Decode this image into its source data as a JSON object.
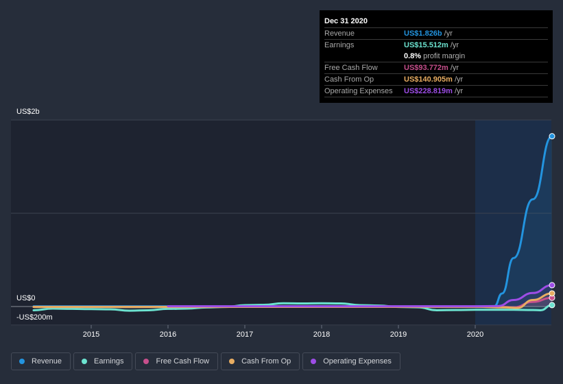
{
  "tooltip": {
    "date": "Dec 31 2020",
    "rows": [
      {
        "label": "Revenue",
        "value": "US$1.826b",
        "unit": "/yr",
        "color": "#2394df"
      },
      {
        "label": "Earnings",
        "value": "US$15.512m",
        "unit": "/yr",
        "color": "#6ce3d0"
      },
      {
        "label": "",
        "value": "0.8%",
        "unit": "profit margin",
        "color": "#ffffff"
      },
      {
        "label": "Free Cash Flow",
        "value": "US$93.772m",
        "unit": "/yr",
        "color": "#c74f8c"
      },
      {
        "label": "Cash From Op",
        "value": "US$140.905m",
        "unit": "/yr",
        "color": "#e8ad62"
      },
      {
        "label": "Operating Expenses",
        "value": "US$228.819m",
        "unit": "/yr",
        "color": "#9d4de6"
      }
    ]
  },
  "legend": [
    {
      "label": "Revenue",
      "color": "#2394df"
    },
    {
      "label": "Earnings",
      "color": "#6ce3d0"
    },
    {
      "label": "Free Cash Flow",
      "color": "#c74f8c"
    },
    {
      "label": "Cash From Op",
      "color": "#e8ad62"
    },
    {
      "label": "Operating Expenses",
      "color": "#9d4de6"
    }
  ],
  "chart_data": {
    "type": "line",
    "title": "",
    "xlabel": "",
    "ylabel": "",
    "unit": "US$ millions",
    "ylim": [
      -200,
      2000
    ],
    "xlim": [
      2014.25,
      2021.0
    ],
    "y_tick_labels": [
      {
        "value": 2000,
        "label": "US$2b"
      },
      {
        "value": 0,
        "label": "US$0"
      },
      {
        "value": -200,
        "label": "-US$200m"
      }
    ],
    "x_tick_labels": [
      {
        "value": 2015,
        "label": "2015"
      },
      {
        "value": 2016,
        "label": "2016"
      },
      {
        "value": 2017,
        "label": "2017"
      },
      {
        "value": 2018,
        "label": "2018"
      },
      {
        "value": 2019,
        "label": "2019"
      },
      {
        "value": 2020,
        "label": "2020"
      }
    ],
    "highlight_from": 2020.0,
    "grid": true,
    "legend_position": "bottom-left",
    "series": [
      {
        "name": "Revenue",
        "color": "#2394df",
        "x": [
          2014.25,
          2016.0,
          2018.0,
          2020.0,
          2020.25,
          2020.35,
          2020.5,
          2020.75,
          2021.0
        ],
        "y": [
          2,
          2,
          2,
          2,
          5,
          140,
          520,
          1150,
          1826
        ]
      },
      {
        "name": "Earnings",
        "color": "#6ce3d0",
        "x": [
          2014.25,
          2014.5,
          2014.75,
          2015.0,
          2015.25,
          2015.5,
          2015.75,
          2016.0,
          2016.25,
          2016.5,
          2016.75,
          2017.0,
          2017.25,
          2017.5,
          2017.75,
          2018.0,
          2018.25,
          2018.5,
          2018.75,
          2019.0,
          2019.25,
          2019.5,
          2019.75,
          2020.0,
          2020.25,
          2020.5,
          2020.75,
          2020.85,
          2021.0
        ],
        "y": [
          -40,
          -22,
          -25,
          -28,
          -30,
          -45,
          -40,
          -25,
          -22,
          -10,
          -5,
          15,
          18,
          35,
          33,
          35,
          33,
          15,
          10,
          -5,
          -8,
          -40,
          -38,
          -35,
          -35,
          -35,
          -38,
          -40,
          15.5
        ]
      },
      {
        "name": "Free Cash Flow",
        "color": "#c74f8c",
        "x": [
          2014.25,
          2016.0,
          2018.0,
          2020.0,
          2020.4,
          2020.5,
          2020.75,
          2021.0
        ],
        "y": [
          -5,
          -5,
          -3,
          -3,
          -5,
          -10,
          50,
          93.8
        ]
      },
      {
        "name": "Cash From Op",
        "color": "#e8ad62",
        "x": [
          2014.25,
          2016.0,
          2018.0,
          2020.0,
          2020.4,
          2020.55,
          2020.75,
          2021.0
        ],
        "y": [
          -5,
          -5,
          -3,
          -3,
          -10,
          -15,
          70,
          140.9
        ]
      },
      {
        "name": "Operating Expenses",
        "color": "#9d4de6",
        "x": [
          2016.0,
          2017.0,
          2018.0,
          2019.0,
          2020.0,
          2020.3,
          2020.5,
          2020.75,
          2021.0
        ],
        "y": [
          3,
          3,
          3,
          3,
          3,
          5,
          70,
          145,
          228.8
        ]
      }
    ]
  }
}
